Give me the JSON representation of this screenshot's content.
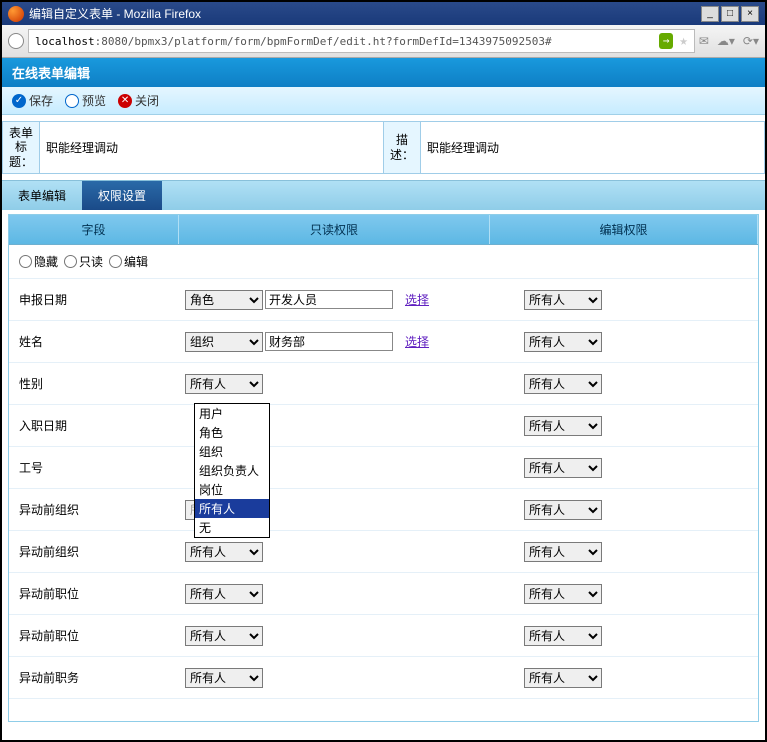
{
  "window": {
    "title": "编辑自定义表单 - Mozilla Firefox",
    "min": "_",
    "max": "□",
    "close": "×"
  },
  "url": {
    "host": "localhost",
    "path": ":8080/bpmx3/platform/form/bpmFormDef/edit.ht?formDefId=1343975092503#"
  },
  "panel": {
    "title": "在线表单编辑"
  },
  "toolbar": {
    "save": "保存",
    "preview": "预览",
    "close": "关闭"
  },
  "meta": {
    "title_label": "表单标题：",
    "title_value": "职能经理调动",
    "desc_label": "描述：",
    "desc_value": "职能经理调动"
  },
  "tabs": {
    "edit": "表单编辑",
    "perm": "权限设置"
  },
  "headers": {
    "field": "字段",
    "readonly": "只读权限",
    "edit": "编辑权限"
  },
  "radios": {
    "hide": "隐藏",
    "ro": "只读",
    "ed": "编辑"
  },
  "select_link": "选择",
  "dropdown_opts": [
    "用户",
    "角色",
    "组织",
    "组织负责人",
    "岗位",
    "所有人",
    "无"
  ],
  "rows": [
    {
      "field": "申报日期",
      "roType": "角色",
      "roVal": "开发人员",
      "roLink": true,
      "edType": "所有人"
    },
    {
      "field": "姓名",
      "roType": "组织",
      "roVal": "财务部",
      "roLink": true,
      "edType": "所有人"
    },
    {
      "field": "性别",
      "roType": "所有人",
      "roVal": "",
      "roLink": false,
      "edType": "所有人",
      "open": true
    },
    {
      "field": "入职日期",
      "roType": "",
      "roVal": "",
      "roLink": false,
      "edType": "所有人",
      "hideRoSel": true
    },
    {
      "field": "工号",
      "roType": "",
      "roVal": "",
      "roLink": false,
      "edType": "所有人",
      "hideRoSel": true
    },
    {
      "field": "异动前组织",
      "roType": "所有人",
      "roVal": "",
      "roLink": false,
      "edType": "所有人",
      "faded": true
    },
    {
      "field": "异动前组织",
      "roType": "所有人",
      "roVal": "",
      "roLink": false,
      "edType": "所有人"
    },
    {
      "field": "异动前职位",
      "roType": "所有人",
      "roVal": "",
      "roLink": false,
      "edType": "所有人"
    },
    {
      "field": "异动前职位",
      "roType": "所有人",
      "roVal": "",
      "roLink": false,
      "edType": "所有人"
    },
    {
      "field": "异动前职务",
      "roType": "所有人",
      "roVal": "",
      "roLink": false,
      "edType": "所有人"
    }
  ]
}
